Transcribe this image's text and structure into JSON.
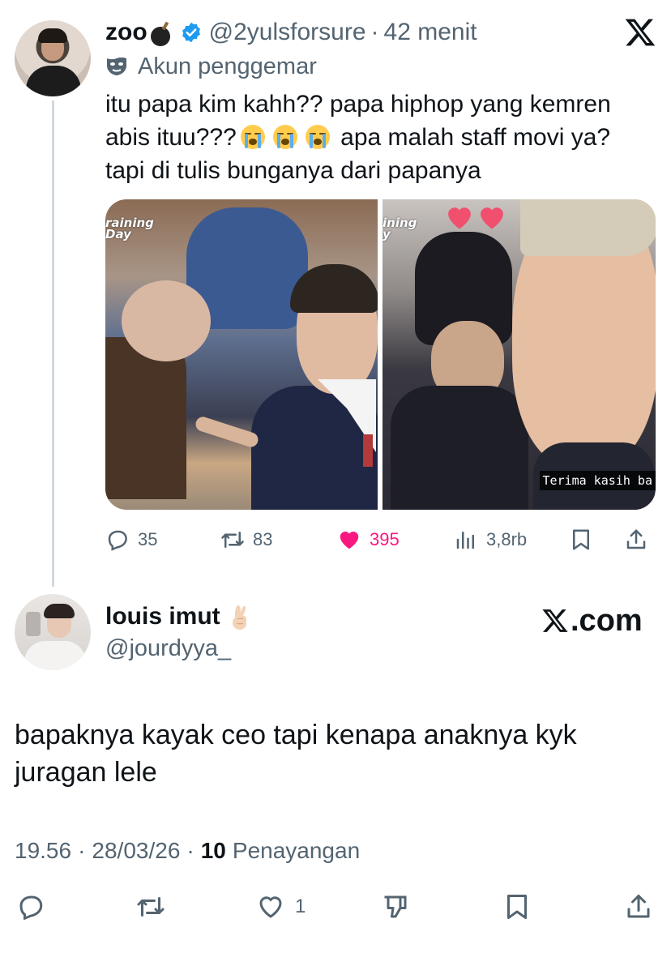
{
  "quoted_tweet": {
    "display_name": "zoo",
    "name_emoji": "bomb-emoji",
    "handle": "@2yulsforsure",
    "separator": "·",
    "time": "42 menit",
    "fan_label": "Akun penggemar",
    "text_line1": "itu papa kim kahh?? papa hiphop yang kemren",
    "text_line2_start": "abis ituu???",
    "text_line2_end": "apa malah staff movi ya?",
    "text_line3": "tapi di tulis bunganya dari papanya",
    "media": {
      "watermark_left_1": "raining",
      "watermark_left_2": "Day",
      "watermark_right_1": "ining",
      "watermark_right_2": "y",
      "subtitle": "Terima kasih ba"
    },
    "stats": {
      "replies": "35",
      "reposts": "83",
      "likes": "395",
      "views": "3,8rb"
    }
  },
  "reply_tweet": {
    "display_name": "louis imut",
    "name_emoji": "crossed-fingers-emoji",
    "handle": "@jourdyya_",
    "site_brand": ".com",
    "text": "bapaknya kayak ceo tapi kenapa anaknya kyk juragan lele",
    "time": "19.56",
    "date": "28/03/26",
    "separator": "·",
    "views_count": "10",
    "views_label": "Penayangan",
    "likes": "1"
  },
  "colors": {
    "text": "#0f1419",
    "secondary": "#536471",
    "like_pink": "#f91880",
    "verified_blue": "#1d9bf0",
    "thread_line": "#cfd9de"
  },
  "icons": [
    "verified-badge-icon",
    "x-logo-icon",
    "mask-icon",
    "reply-icon",
    "repost-icon",
    "heart-icon",
    "views-icon",
    "bookmark-icon",
    "share-icon",
    "dislike-icon"
  ]
}
